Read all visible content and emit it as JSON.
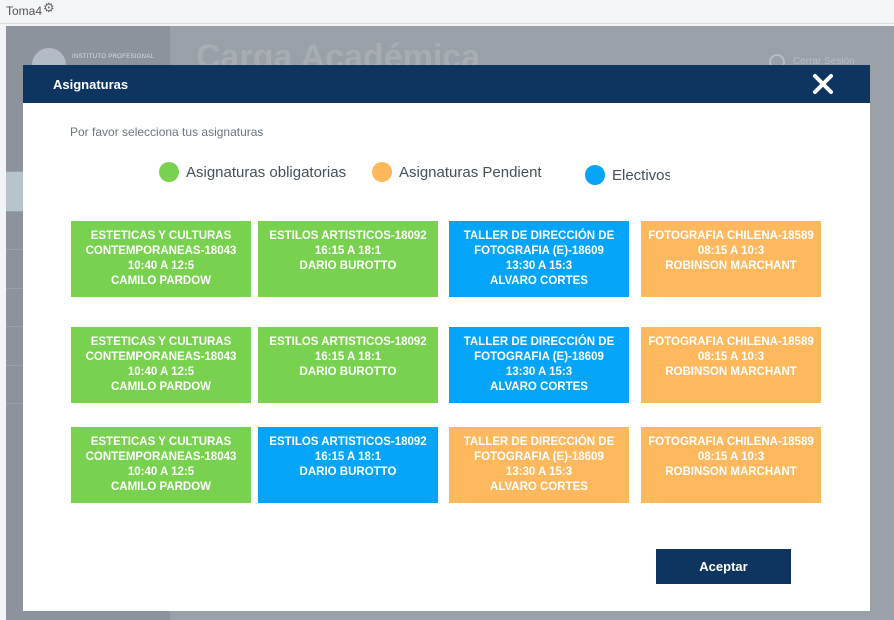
{
  "topbar": {
    "tab_name": "Toma4",
    "gear_icon": "gear-icon"
  },
  "background": {
    "logo_text": "INSTITUTO PROFESIONAL",
    "page_title": "Carga Académica",
    "logout_label": "Cerrar Sesión"
  },
  "modal": {
    "title": "Asignaturas",
    "instruction": "Por favor selecciona tus asignaturas",
    "legend": [
      {
        "label": "Asignaturas obligatorias",
        "color": "#79d150"
      },
      {
        "label": "Asignaturas Pendient",
        "color": "#feb85d"
      },
      {
        "label": "Electivos",
        "color": "#04a5f9"
      }
    ],
    "rows": [
      [
        {
          "name": "ESTETICAS Y CULTURAS CONTEMPORANEAS-18043",
          "time": "10:40 A 12:5",
          "prof": "CAMILO PARDOW",
          "color": "green"
        },
        {
          "name": "ESTILOS ARTISTICOS-18092",
          "time": "16:15 A 18:1",
          "prof": "DARIO BUROTTO",
          "color": "green"
        },
        {
          "name": "TALLER DE DIRECCIÓN DE FOTOGRAFIA (E)-18609",
          "time": "13:30 A 15:3",
          "prof": "ALVARO CORTES",
          "color": "blue"
        },
        {
          "name": "FOTOGRAFIA CHILENA-18589",
          "time": "08:15 A 10:3",
          "prof": "ROBINSON MARCHANT",
          "color": "orange"
        }
      ],
      [
        {
          "name": "ESTETICAS Y CULTURAS CONTEMPORANEAS-18043",
          "time": "10:40 A 12:5",
          "prof": "CAMILO PARDOW",
          "color": "green"
        },
        {
          "name": "ESTILOS ARTISTICOS-18092",
          "time": "16:15 A 18:1",
          "prof": "DARIO BUROTTO",
          "color": "green"
        },
        {
          "name": "TALLER DE DIRECCIÓN DE FOTOGRAFIA (E)-18609",
          "time": "13:30 A 15:3",
          "prof": "ALVARO CORTES",
          "color": "blue"
        },
        {
          "name": "FOTOGRAFIA CHILENA-18589",
          "time": "08:15 A 10:3",
          "prof": "ROBINSON MARCHANT",
          "color": "orange"
        }
      ],
      [
        {
          "name": "ESTETICAS Y CULTURAS CONTEMPORANEAS-18043",
          "time": "10:40 A 12:5",
          "prof": "CAMILO PARDOW",
          "color": "green"
        },
        {
          "name": "ESTILOS ARTISTICOS-18092",
          "time": "16:15 A 18:1",
          "prof": "DARIO BUROTTO",
          "color": "blue"
        },
        {
          "name": "TALLER DE DIRECCIÓN DE FOTOGRAFIA (E)-18609",
          "time": "13:30 A 15:3",
          "prof": "ALVARO CORTES",
          "color": "orange"
        },
        {
          "name": "FOTOGRAFIA CHILENA-18589",
          "time": "08:15 A 10:3",
          "prof": "ROBINSON MARCHANT",
          "color": "orange"
        }
      ]
    ],
    "accept_label": "Aceptar",
    "close_icon": "close-icon"
  }
}
